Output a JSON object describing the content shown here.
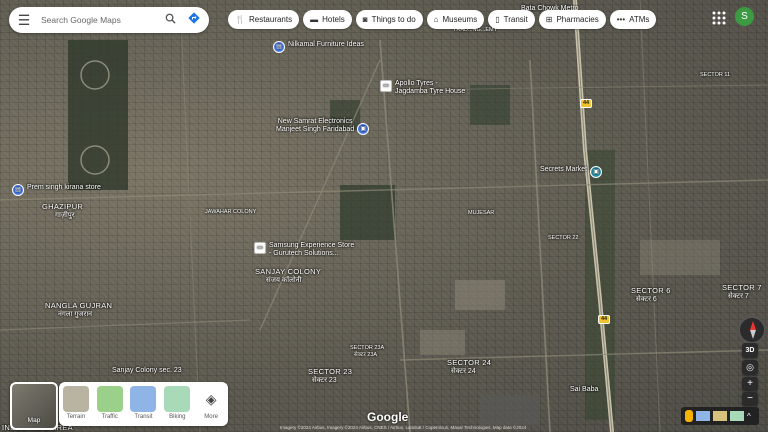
{
  "search": {
    "placeholder": "Search Google Maps"
  },
  "icons": {
    "menu": "hamburger-menu",
    "search": "magnifier",
    "directions": "directions-diamond",
    "apps": "grid-9-dots"
  },
  "chips": [
    {
      "label": "Restaurants",
      "icon": "fork-knife-icon"
    },
    {
      "label": "Hotels",
      "icon": "bed-icon"
    },
    {
      "label": "Things to do",
      "icon": "camera-icon"
    },
    {
      "label": "Museums",
      "icon": "museum-icon"
    },
    {
      "label": "Transit",
      "icon": "train-icon"
    },
    {
      "label": "Pharmacies",
      "icon": "pharmacy-icon"
    },
    {
      "label": "ATMs",
      "icon": "more-dots-icon"
    }
  ],
  "account": {
    "initial": "S",
    "color": "#3c9a42"
  },
  "map_labels": {
    "bata_chowk": "Bata Chowk Metro",
    "trade_area": "TRAD...NG...EMY",
    "nilkamal": "Nilkamal Furniture Ideas",
    "apollo_tyres": "Apollo Tyres -",
    "jagdamba": "Jagdamba Tyre House",
    "new_samrat": "New Samrat Electronics",
    "manjeet": "Manjeet Singh Faridabad",
    "prem_singh": "Prem singh kirana store",
    "ghazipur": "GHAZIPUR",
    "ghazipur_hi": "गाज़ीपुर",
    "samsung": "Samsung Experience Store",
    "samsung2": "- Gurutech Solutions...",
    "sanjay_colony": "SANJAY COLONY",
    "sanjay_colony_hi": "संजय कॉलोनी",
    "nangla": "NANGLA GUJRAN",
    "nangla_hi": "नंगला गुजरान",
    "sector_23a": "SECTOR 23A",
    "sector_23a_hi": "सेक्टर 23A",
    "sector_23": "SECTOR 23",
    "sector_23_hi": "सेक्टर 23",
    "sector_24": "SECTOR 24",
    "sector_24_hi": "सेक्टर 24",
    "sector_6": "SECTOR 6",
    "sector_6_hi": "सेक्टर 6",
    "sector_7": "SECTOR 7",
    "sector_7_hi": "सेक्टर 7",
    "sector_11": "SECTOR 11",
    "secrets_market": "Secrets Market",
    "sector_22": "SECTOR 22",
    "sai_dham": "Sai Baba",
    "sanjay_colony_23": "Sanjay Colony sec. 23",
    "industrial_area": "INDUSTRIAL AREA",
    "jawahar_colony": "JAWAHAR COLONY",
    "muslim": "MUJESAR",
    "highway_44": "44"
  },
  "controls": {
    "view_3d": "3D",
    "zoom_in": "+",
    "zoom_out": "−",
    "expand": "^"
  },
  "layers": {
    "current_label": "Map",
    "options": [
      {
        "label": "Terrain",
        "color": "#b9b4a2"
      },
      {
        "label": "Traffic",
        "color": "#9ad08a"
      },
      {
        "label": "Transit",
        "color": "#8fb4e6"
      },
      {
        "label": "Biking",
        "color": "#a8d9b8"
      },
      {
        "label": "More",
        "color": "#ffffff"
      }
    ]
  },
  "footer": {
    "brand": "Google",
    "attribution": "Imagery ©2024 Airbus, Imagery ©2024 Airbus, CNES / Airbus, Landsat / Copernicus, Maxar Technologies, Map data ©2024"
  }
}
